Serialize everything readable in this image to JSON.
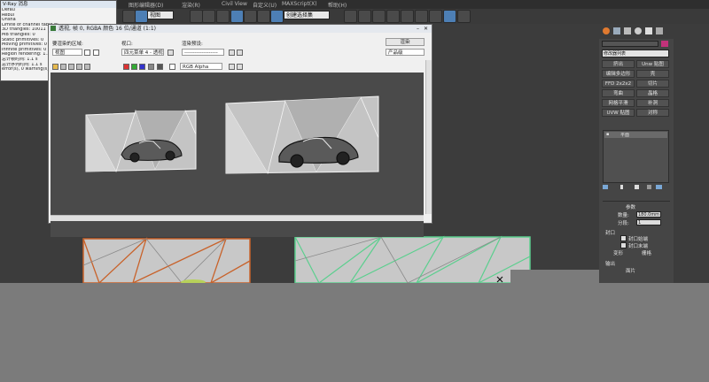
{
  "menu": {
    "items": [
      "图形编辑器(D)",
      "渲染(R)",
      "Civil View",
      "自定义(U)",
      "MAXScript(X)",
      "帮助(H)"
    ]
  },
  "toolbar": {
    "view_select": "视图",
    "selection_set": "创建选择集"
  },
  "log_window": {
    "title": "V-Ray 消息",
    "lines": [
      "Defau",
      "Rebui",
      "Unsha",
      "Limite of channel table pl",
      "3D triangles: 10011",
      "MB triangles: 0",
      "Static primitives: 0",
      "Moving primitives: 0",
      "Infinite primitives: 0",
      "Region rendering: 1.1 s",
      "总计帧时间: 1.1 s",
      "总计序列时间: 1.1 s",
      "error(s), 0 warning(s)"
    ]
  },
  "frame_buffer": {
    "title": "透视, 帧 0, RGBA 颜色 16 位/通道 (1:1)",
    "label_area": "要渲染的区域:",
    "label_viewport": "视口:",
    "label_preset": "渲染预设:",
    "area_value": "视图",
    "viewport_value": "四元菜单 4 - 透视",
    "preset_value": "-------------------",
    "render_button": "渲染",
    "product_value": "产品级",
    "channel_value": "RGB Alpha"
  },
  "command_panel": {
    "modifier_list": "修改器列表",
    "buttons": [
      [
        "挤出",
        "Unw 贴图"
      ],
      [
        "编辑多边形",
        "壳"
      ],
      [
        "FFD 2x2x2",
        "切片"
      ],
      [
        "弯曲",
        "晶格"
      ],
      [
        "网格平滑",
        "补洞"
      ],
      [
        "UVW 贴图",
        "对称"
      ]
    ],
    "stack_item": "平面",
    "rollout_title": "参数",
    "count_label": "数量:",
    "count_value": "180.0mm",
    "segments_label": "分段:",
    "segments_value": "1",
    "cap_label": "封口",
    "cap_start": "封口始端",
    "cap_end": "封口末端",
    "morph": "变形",
    "grid": "栅格",
    "output_label": "输出",
    "patch": "面片"
  },
  "colors": {
    "selection": "#4d7fb5",
    "shape_a_stroke": "#c8622a",
    "shape_b_stroke": "#5bcf8e"
  }
}
